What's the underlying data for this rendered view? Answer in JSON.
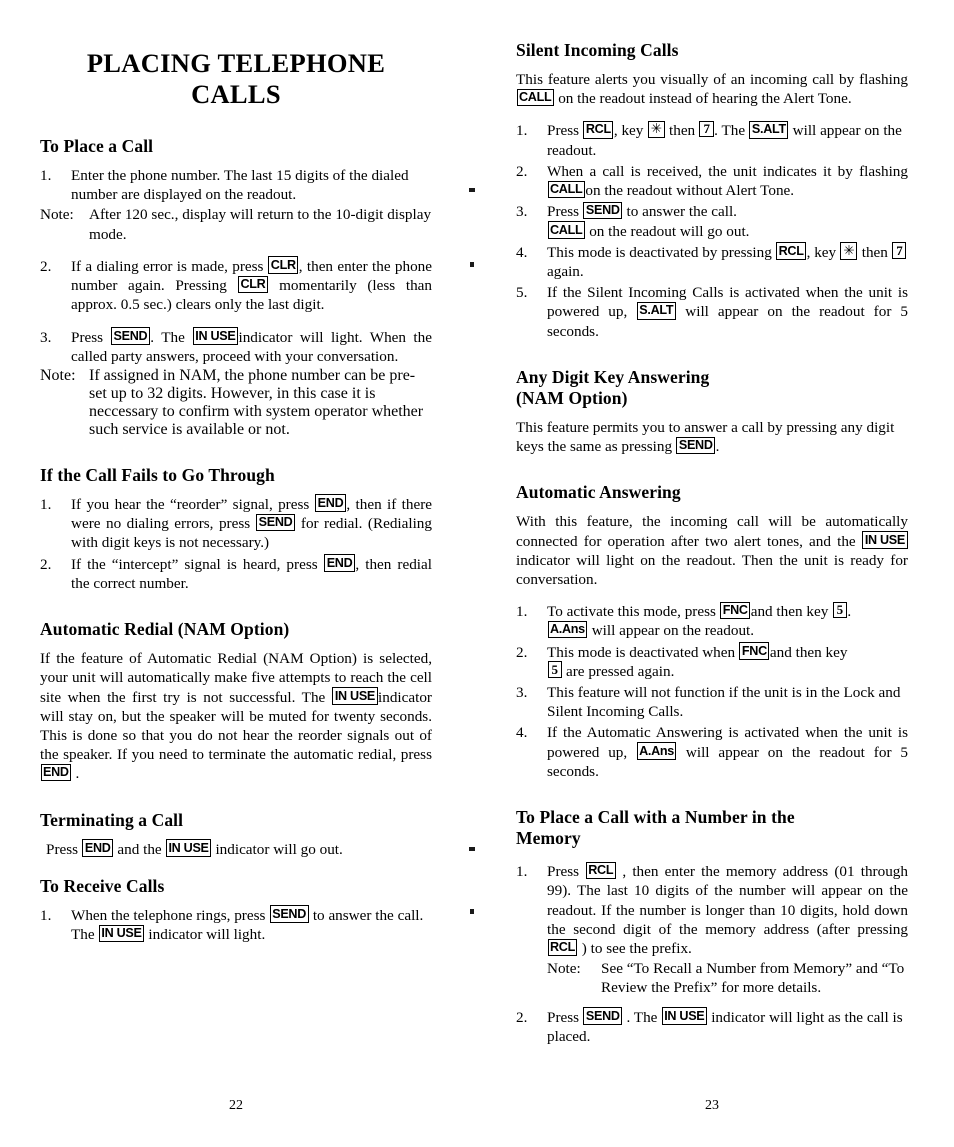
{
  "document": {
    "title": "PLACING TELEPHONE CALLS",
    "title_line1": "PLACING TELEPHONE",
    "title_line2": "CALLS"
  },
  "keys": {
    "clr": "CLR",
    "send": "SEND",
    "end": "END",
    "in_use": "IN USE",
    "rcl": "RCL",
    "star": "✳",
    "seven": "7",
    "five": "5",
    "salt": "S.ALT",
    "call": "CALL",
    "fnc": "FNC",
    "a_ans": "A.Ans"
  },
  "left_column": {
    "sections": [
      {
        "heading": "To Place a Call",
        "steps": [
          {
            "num": "1.",
            "text_a": "Enter the phone number.  The last 15 digits of the dialed number are displayed on the readout.",
            "note_label": "Note:",
            "note_text": "After 120 sec., display will return to the 10-digit display mode."
          },
          {
            "num": "2.",
            "text_a": "If a dialing error is made, press ",
            "text_b": ", then enter the phone number again.   Pressing ",
            "text_c": " momentarily (less than approx. 0.5 sec.) clears only the last digit."
          },
          {
            "num": "3.",
            "text_a": "Press ",
            "text_b": ". The ",
            "text_c": "indicator will light. When the called party answers, proceed with your conversation."
          }
        ],
        "trailing_note_label": "Note:",
        "trailing_note_text": "If assigned in NAM, the phone number can be pre-set up to 32 digits. However, in this case it is neccessary to confirm with system operator whether such service is available or not."
      },
      {
        "heading": "If the Call Fails to Go Through",
        "steps": [
          {
            "num": "1.",
            "text_a": "If you hear the “reorder” signal, press ",
            "text_b": ", then if there were no dialing errors, press ",
            "text_c": " for redial.  (Redialing with digit keys is not necessary.)"
          },
          {
            "num": "2.",
            "text_a": "If the “intercept” signal is heard, press ",
            "text_b": ", then redial the correct number."
          }
        ]
      },
      {
        "heading": "Automatic Redial (NAM Option)",
        "para_a": "If the feature of Automatic Redial (NAM Option) is selected, your unit will automatically make five attempts to reach the cell site when the first try is not successful. The ",
        "para_b": "indicator will stay on, but the speaker will be muted for twenty seconds.  This is done so that you do not hear the reorder signals out of the speaker. If you need to terminate the automatic redial, press ",
        "para_c": " ."
      },
      {
        "heading": "Terminating a Call",
        "para_a": "Press ",
        "para_b": " and the ",
        "para_c": " indicator will go out."
      },
      {
        "heading": "To Receive Calls",
        "steps": [
          {
            "num": "1.",
            "text_a": "When the telephone rings, press ",
            "text_b": " to answer the call. The ",
            "text_c": " indicator will light."
          }
        ]
      }
    ],
    "folio": "22"
  },
  "right_column": {
    "sections": [
      {
        "heading": "Silent Incoming Calls",
        "para_a": "This feature alerts you visually of an incoming call by flashing ",
        "para_b": " on the readout instead of hearing the Alert Tone.",
        "steps": [
          {
            "num": "1.",
            "text_a": "Press ",
            "text_b": ", key ",
            "text_c": " then ",
            "text_d": ". The ",
            "text_e": " will appear on the readout."
          },
          {
            "num": "2.",
            "text_a": "When a call is received, the unit indicates it by flashing ",
            "text_b": "on the readout without Alert Tone."
          },
          {
            "num": "3.",
            "text_a": "Press ",
            "text_b": " to answer the call.",
            "text_c": " on the readout will go out."
          },
          {
            "num": "4.",
            "text_a": "This mode is deactivated by pressing ",
            "text_b": ", key ",
            "text_c": " then ",
            "text_d": " again."
          },
          {
            "num": "5.",
            "text_a": "If the Silent Incoming Calls is activated when the unit is powered up, ",
            "text_b": " will appear on the readout for 5 seconds."
          }
        ]
      },
      {
        "heading_line1": "Any Digit Key Answering",
        "heading_line2": "(NAM Option)",
        "para_a": "This feature permits you to answer a call by pressing any digit keys the same as pressing ",
        "para_b": "."
      },
      {
        "heading": "Automatic Answering",
        "para_a": "With this feature, the incoming call will be automatically connected for operation after two alert tones, and the ",
        "para_b": " indicator will light on the readout. Then the unit is ready for conversation.",
        "steps": [
          {
            "num": "1.",
            "text_a": "To activate this mode, press ",
            "text_b": "and then key ",
            "text_c": ".",
            "text_d": " will appear on the readout."
          },
          {
            "num": "2.",
            "text_a": "This mode is deactivated when ",
            "text_b": "and then key ",
            "text_c": " are pressed again."
          },
          {
            "num": "3.",
            "text_a": "This feature will not function if the unit is in the Lock and Silent Incoming Calls."
          },
          {
            "num": "4.",
            "text_a": "If the Automatic Answering is activated when the unit is powered up, ",
            "text_b": " will appear on the readout for 5 seconds."
          }
        ]
      },
      {
        "heading_line1": "To Place a Call with a Number in the",
        "heading_line2": "Memory",
        "steps": [
          {
            "num": "1.",
            "text_a": "Press ",
            "text_b": " , then enter the memory address (01 through 99). The last 10 digits of the number will appear on the readout.  If the number is longer than 10 digits, hold down the second digit of the memory address (after pressing ",
            "text_c": " ) to see the prefix.",
            "note_label": "Note:",
            "note_text": "See “To Recall a Number from Memory” and “To Review the Prefix” for more details."
          },
          {
            "num": "2.",
            "text_a": "Press ",
            "text_b": " .  The ",
            "text_c": " indicator will light as the call is placed."
          }
        ]
      }
    ],
    "folio": "23"
  }
}
